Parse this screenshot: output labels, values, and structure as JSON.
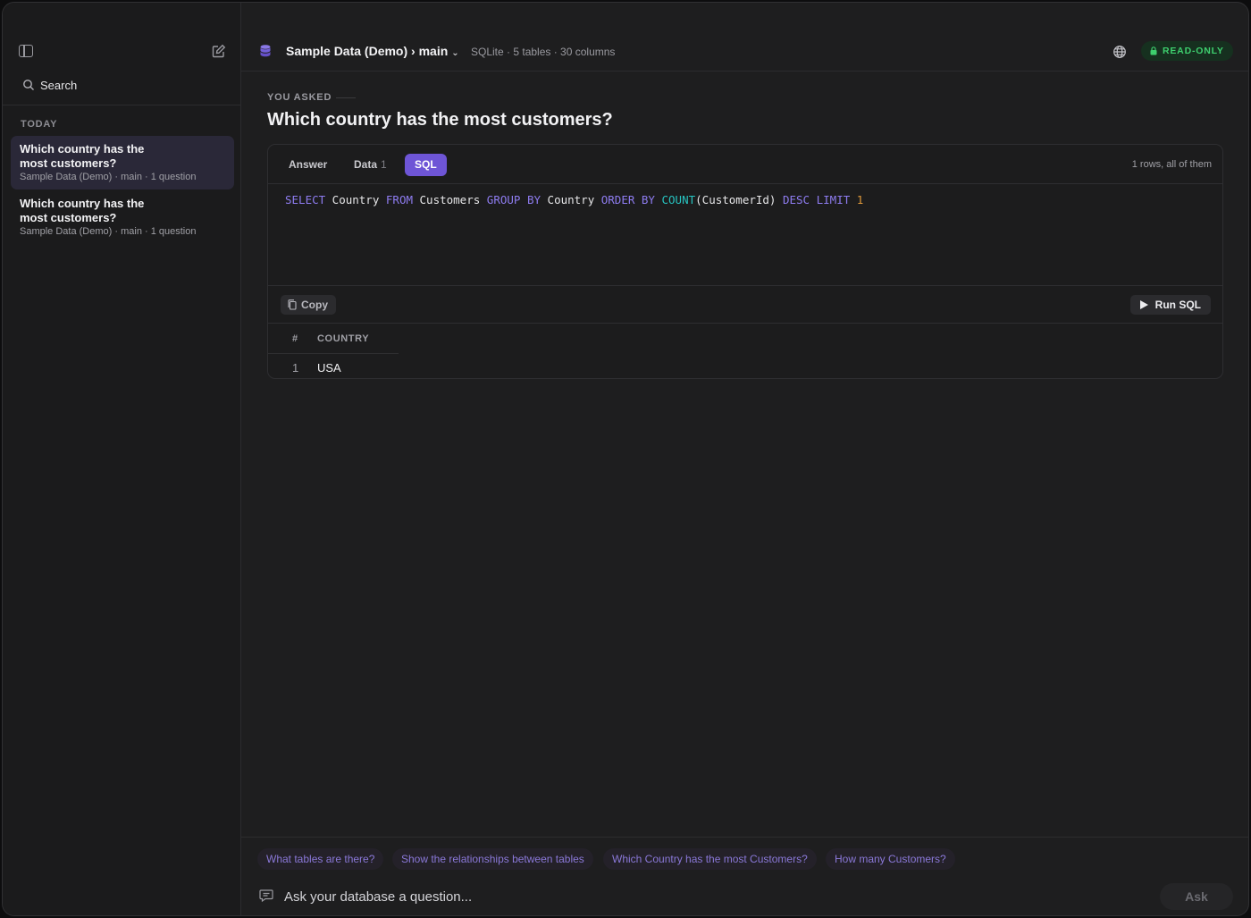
{
  "sidebar": {
    "search_placeholder": "Search",
    "section_label": "TODAY",
    "conversations": [
      {
        "title": "Which country has the most customers?",
        "meta": "Sample Data (Demo) · main · 1 question",
        "active": true
      },
      {
        "title": "Which country has the most customers?",
        "meta": "Sample Data (Demo) · main · 1 question",
        "active": false
      }
    ]
  },
  "header": {
    "db_title": "Sample Data (Demo) › main",
    "db_meta": "SQLite · 5 tables · 30 columns",
    "badge": "READ-ONLY"
  },
  "question": {
    "label": "YOU ASKED",
    "text": "Which country has the most customers?"
  },
  "card": {
    "tabs": [
      {
        "label": "Answer",
        "count": ""
      },
      {
        "label": "Data",
        "count": "1"
      },
      {
        "label": "SQL",
        "count": ""
      }
    ],
    "active_tab": "SQL",
    "rows_note": "1 rows, all of them",
    "sql_tokens": [
      {
        "t": "SELECT",
        "c": "kw"
      },
      {
        "t": " Country ",
        "c": ""
      },
      {
        "t": "FROM",
        "c": "kw"
      },
      {
        "t": " Customers ",
        "c": ""
      },
      {
        "t": "GROUP BY",
        "c": "kw"
      },
      {
        "t": " Country ",
        "c": ""
      },
      {
        "t": "ORDER BY",
        "c": "kw"
      },
      {
        "t": " ",
        "c": ""
      },
      {
        "t": "COUNT",
        "c": "fn"
      },
      {
        "t": "(CustomerId) ",
        "c": ""
      },
      {
        "t": "DESC",
        "c": "kw"
      },
      {
        "t": " ",
        "c": ""
      },
      {
        "t": "LIMIT",
        "c": "kw"
      },
      {
        "t": " ",
        "c": ""
      },
      {
        "t": "1",
        "c": "num"
      }
    ],
    "copy_label": "Copy",
    "run_label": "Run SQL",
    "result": {
      "headers": {
        "num": "#",
        "col": "COUNTRY"
      },
      "rows": [
        {
          "num": "1",
          "country": "USA"
        }
      ]
    }
  },
  "suggestions": [
    "What tables are there?",
    "Show the relationships between tables",
    "Which Country has the most Customers?",
    "How many Customers?"
  ],
  "composer": {
    "placeholder": "Ask your database a question...",
    "ask_label": "Ask"
  },
  "colors": {
    "accent": "#6e55d6",
    "badge_green": "#3ecf6e",
    "suggestion_text": "#8a78d8"
  }
}
